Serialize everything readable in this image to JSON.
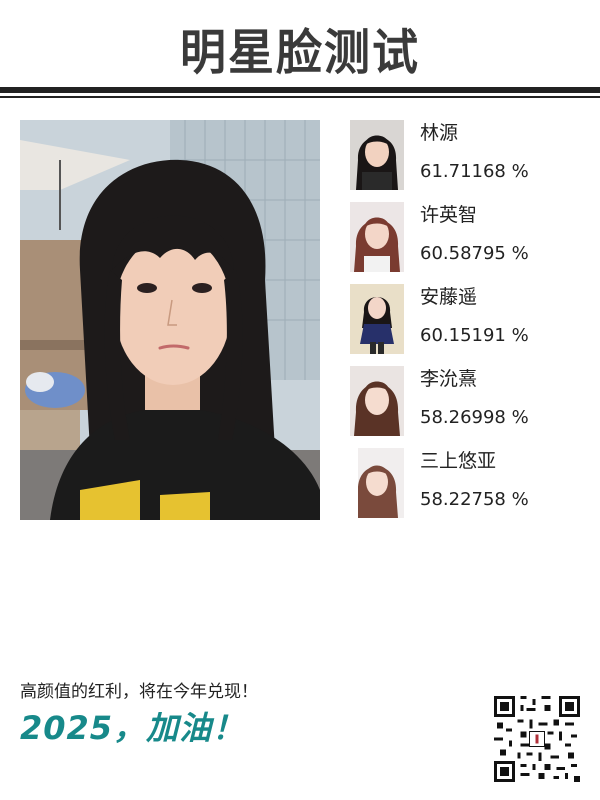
{
  "header": {
    "title": "明星脸测试"
  },
  "matches": [
    {
      "name": "林源",
      "score": "61.71168 %",
      "thumb_icon": "celebrity-portrait"
    },
    {
      "name": "许英智",
      "score": "60.58795 %",
      "thumb_icon": "celebrity-portrait"
    },
    {
      "name": "安藤遥",
      "score": "60.15191 %",
      "thumb_icon": "celebrity-portrait"
    },
    {
      "name": "李沇熹",
      "score": "58.26998 %",
      "thumb_icon": "celebrity-portrait"
    },
    {
      "name": "三上悠亚",
      "score": "58.22758 %",
      "thumb_icon": "celebrity-portrait"
    }
  ],
  "footer": {
    "slogan": "高颜值的红利，将在今年兑现！",
    "cheer": "2025，加油！",
    "qr_icon": "qr-code-icon"
  },
  "colors": {
    "accent": "#17898a",
    "text": "#222222",
    "rule": "#222222"
  }
}
